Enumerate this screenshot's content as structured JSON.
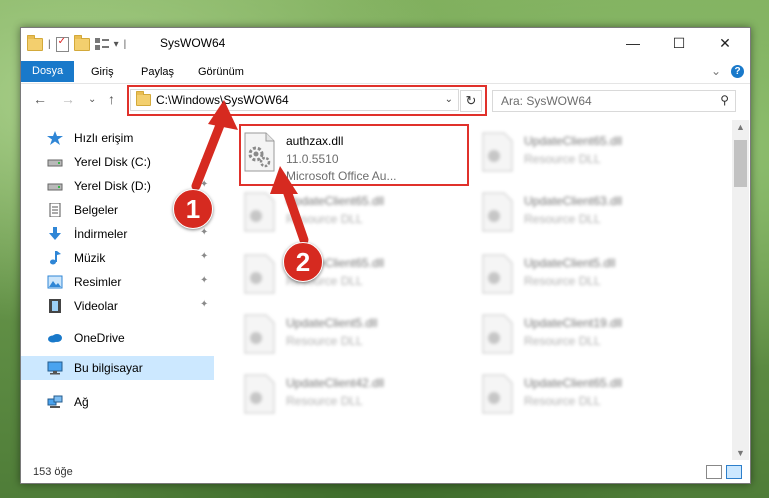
{
  "window": {
    "title": "SysWOW64",
    "controls": {
      "minimize": "—",
      "maximize": "☐",
      "close": "✕"
    }
  },
  "ribbon": {
    "tabs": [
      {
        "label": "Dosya",
        "active": true
      },
      {
        "label": "Giriş",
        "active": false
      },
      {
        "label": "Paylaş",
        "active": false
      },
      {
        "label": "Görünüm",
        "active": false
      }
    ],
    "expand_glyph": "⌄",
    "help_glyph": "?"
  },
  "navigation": {
    "back_glyph": "←",
    "forward_glyph": "→",
    "recent_glyph": "⌄",
    "up_glyph": "↑",
    "address": "C:\\Windows\\SysWOW64",
    "refresh_glyph": "↻",
    "search_placeholder": "Ara: SysWOW64",
    "search_glyph": "⚲"
  },
  "sidebar": {
    "items": [
      {
        "label": "Hızlı erişim",
        "icon": "star-icon",
        "pinned": false
      },
      {
        "label": "Yerel Disk (C:)",
        "icon": "drive-icon",
        "pinned": true
      },
      {
        "label": "Yerel Disk (D:)",
        "icon": "drive-icon",
        "pinned": true
      },
      {
        "label": "Belgeler",
        "icon": "document-icon",
        "pinned": true
      },
      {
        "label": "İndirmeler",
        "icon": "download-icon",
        "pinned": true
      },
      {
        "label": "Müzik",
        "icon": "music-icon",
        "pinned": true
      },
      {
        "label": "Resimler",
        "icon": "pictures-icon",
        "pinned": true
      },
      {
        "label": "Videolar",
        "icon": "video-icon",
        "pinned": true
      },
      {
        "label": "OneDrive",
        "icon": "cloud-icon",
        "pinned": false
      },
      {
        "label": "Bu bilgisayar",
        "icon": "computer-icon",
        "pinned": false,
        "selected": true
      },
      {
        "label": "Ağ",
        "icon": "network-icon",
        "pinned": false
      }
    ],
    "pin_glyph": "📌"
  },
  "files": {
    "highlighted": {
      "name": "authzax.dll",
      "version": "11.0.5510",
      "description": "Microsoft Office Au..."
    },
    "left_column": [
      {
        "name": "UpdateClient65.dll",
        "type": "Resource DLL"
      },
      {
        "name": "UpdateClient65.dll",
        "type": "Resource DLL"
      },
      {
        "name": "UpdateClient5.dll",
        "type": "Resource DLL"
      },
      {
        "name": "UpdateClient42.dll",
        "type": "Resource DLL"
      }
    ],
    "right_column": [
      {
        "name": "UpdateClient65.dll",
        "type": "Resource DLL"
      },
      {
        "name": "UpdateClient63.dll",
        "type": "Resource DLL"
      },
      {
        "name": "UpdateClient5.dll",
        "type": "Resource DLL"
      },
      {
        "name": "UpdateClient19.dll",
        "type": "Resource DLL"
      },
      {
        "name": "UpdateClient65.dll",
        "type": "Resource DLL"
      }
    ]
  },
  "status": {
    "item_count": "153 öğe"
  },
  "callouts": [
    "1",
    "2"
  ],
  "colors": {
    "accent": "#1979ca",
    "highlight": "#e0312b",
    "callout": "#d62a20",
    "selection": "#cce8ff"
  }
}
